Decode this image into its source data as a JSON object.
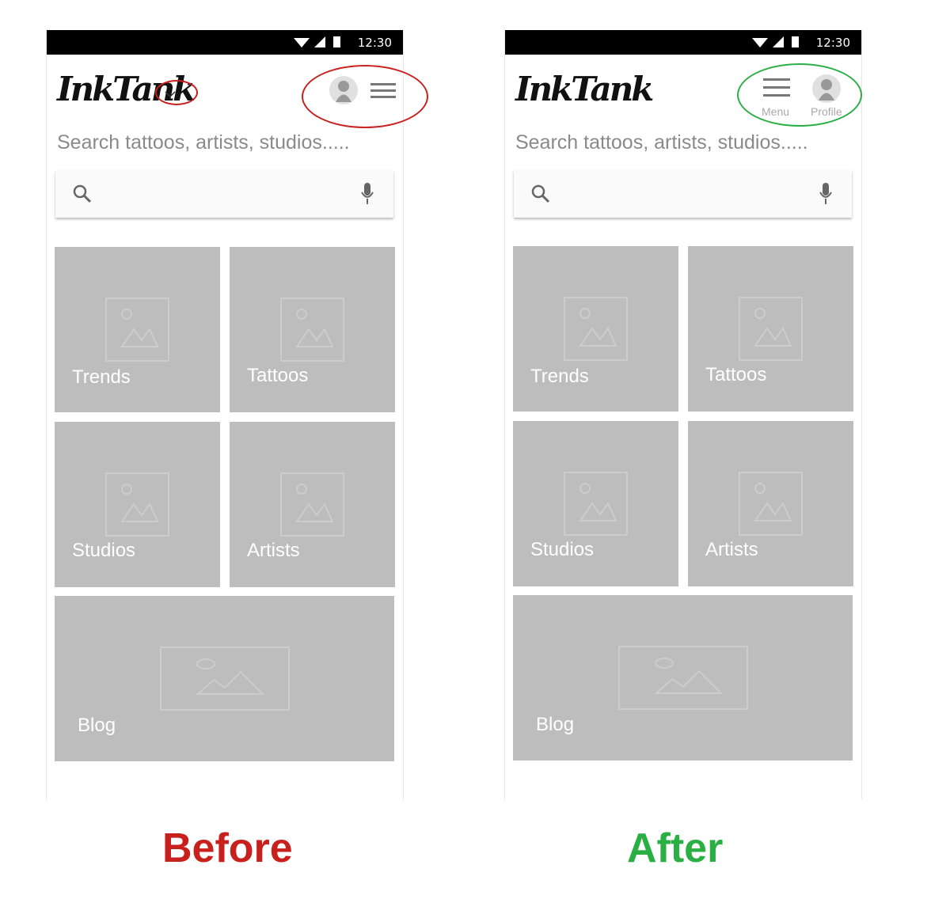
{
  "status_bar": {
    "time": "12:30"
  },
  "app": {
    "logo": "InkTank"
  },
  "search": {
    "prompt": "Search tattoos, artists, studios....."
  },
  "header_after": {
    "menu_label": "Menu",
    "profile_label": "Profile"
  },
  "tiles": [
    "Trends",
    "Tattoos",
    "Studios",
    "Artists",
    "Blog"
  ],
  "captions": {
    "before": "Before",
    "after": "After"
  },
  "colors": {
    "before_highlight": "#c8201d",
    "after_highlight": "#2aaf45",
    "tile_bg": "#bdbdbd"
  },
  "icons": [
    "wifi-icon",
    "signal-icon",
    "battery-icon",
    "chevron-down-icon",
    "avatar-icon",
    "menu-icon",
    "search-icon",
    "mic-icon",
    "image-placeholder-icon"
  ]
}
